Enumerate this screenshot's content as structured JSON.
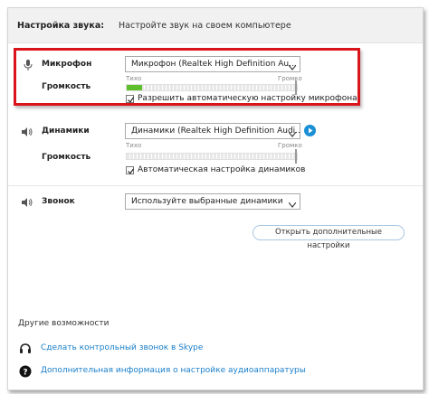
{
  "header": {
    "title": "Настройка звука:",
    "subtitle": "Настройте звук на своем компьютере"
  },
  "microphone": {
    "label": "Микрофон",
    "device": "Микрофон (Realtek High Definition Au...",
    "volume_label": "Громкость",
    "scale_low": "Тихо",
    "scale_high": "Громко",
    "level": 0.09,
    "auto_label": "Разрешить автоматическую настройку микрофона",
    "auto_checked": true
  },
  "speakers": {
    "label": "Динамики",
    "device": "Динамики (Realtek High Definition Audi...",
    "volume_label": "Громкость",
    "scale_low": "Тихо",
    "scale_high": "Громко",
    "level": 0.0,
    "auto_label": "Автоматическая настройка динамиков",
    "auto_checked": true
  },
  "ringer": {
    "label": "Звонок",
    "device": "Используйте выбранные динамики"
  },
  "advanced_button": "Открыть дополнительные настройки",
  "other": {
    "title": "Другие возможности",
    "links": [
      {
        "text": "Сделать контрольный звонок в Skype",
        "icon": "headset-icon"
      },
      {
        "text": "Дополнительная информация о настройке аудиоаппаратуры",
        "icon": "help-icon"
      }
    ]
  },
  "colors": {
    "highlight": "#d9141b",
    "meter_fill": "#5fbf2a",
    "link": "#1a7fc9",
    "play_button": "#1a8fd6"
  }
}
